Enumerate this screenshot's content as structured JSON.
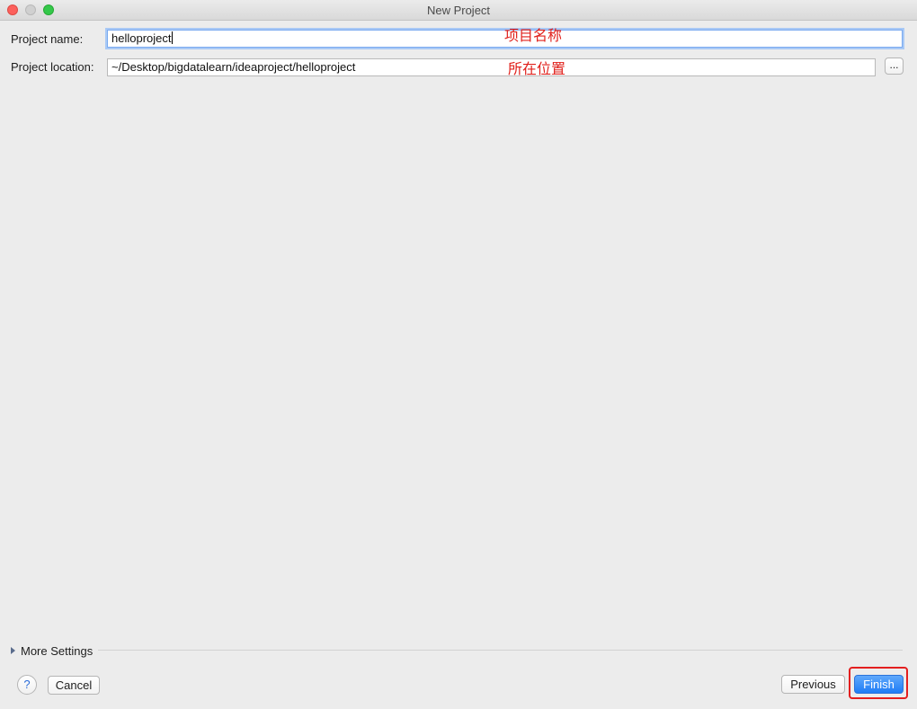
{
  "window": {
    "title": "New Project"
  },
  "form": {
    "project_name_label": "Project name:",
    "project_name_value": "helloproject",
    "project_location_label": "Project location:",
    "project_location_value": "~/Desktop/bigdatalearn/ideaproject/helloproject",
    "browse_label": "..."
  },
  "annotations": {
    "name_note": "项目名称",
    "location_note": "所在位置",
    "color": "#e0201b"
  },
  "more_settings": {
    "label": "More Settings",
    "icon": "disclosure-triangle-right-icon"
  },
  "footer": {
    "help_label": "?",
    "cancel_label": "Cancel",
    "previous_label": "Previous",
    "finish_label": "Finish"
  },
  "colors": {
    "accent": "#1e7cf6",
    "highlight": "#e31f1f",
    "background": "#ececec"
  }
}
